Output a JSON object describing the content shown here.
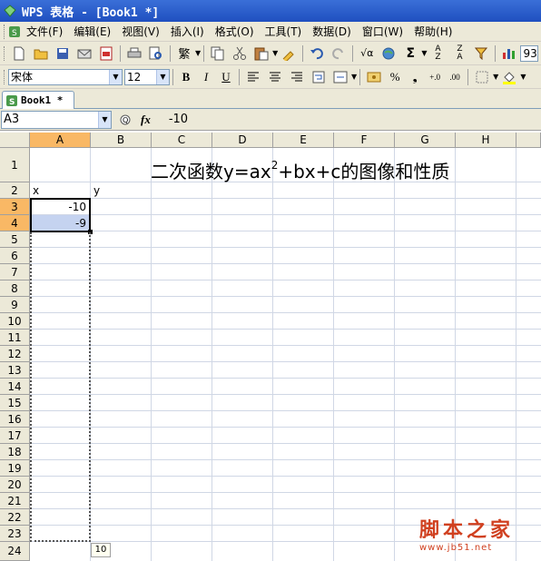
{
  "window": {
    "title": "WPS 表格 - [Book1 *]"
  },
  "menu": [
    "文件(F)",
    "编辑(E)",
    "视图(V)",
    "插入(I)",
    "格式(O)",
    "工具(T)",
    "数据(D)",
    "窗口(W)",
    "帮助(H)"
  ],
  "toolbar": {
    "zoom_value": "93"
  },
  "format_bar": {
    "font_name": "宋体",
    "font_size": "12",
    "bold": "B",
    "italic": "I",
    "underline": "U",
    "percent": "%",
    "comma": "❟",
    "inc_decimal": "+.0",
    "dec_decimal": ".00"
  },
  "doc_tab": {
    "label": "Book1 *"
  },
  "formula_bar": {
    "cell_ref": "A3",
    "fx_label": "fx",
    "value": "-10"
  },
  "sheet": {
    "columns": [
      "A",
      "B",
      "C",
      "D",
      "E",
      "F",
      "G",
      "H"
    ],
    "rows": [
      "1",
      "2",
      "3",
      "4",
      "5",
      "6",
      "7",
      "8",
      "9",
      "10",
      "11",
      "12",
      "13",
      "14",
      "15",
      "16",
      "17",
      "18",
      "19",
      "20",
      "21",
      "22",
      "23",
      "24"
    ],
    "title_main": "二次函数y=ax",
    "title_sup": "2",
    "title_rest": "+bx+c的图像和性质",
    "a2": "x",
    "b2": "y",
    "a3": "-10",
    "a4": "-9",
    "drag_tooltip": "10"
  },
  "watermark": {
    "text": "脚本之家",
    "url": "www.jb51.net"
  },
  "colors": {
    "title_bar": "#1f4fc0",
    "active_header": "#f9b865",
    "selection": "#c5d3f0",
    "watermark": "#d04020"
  }
}
